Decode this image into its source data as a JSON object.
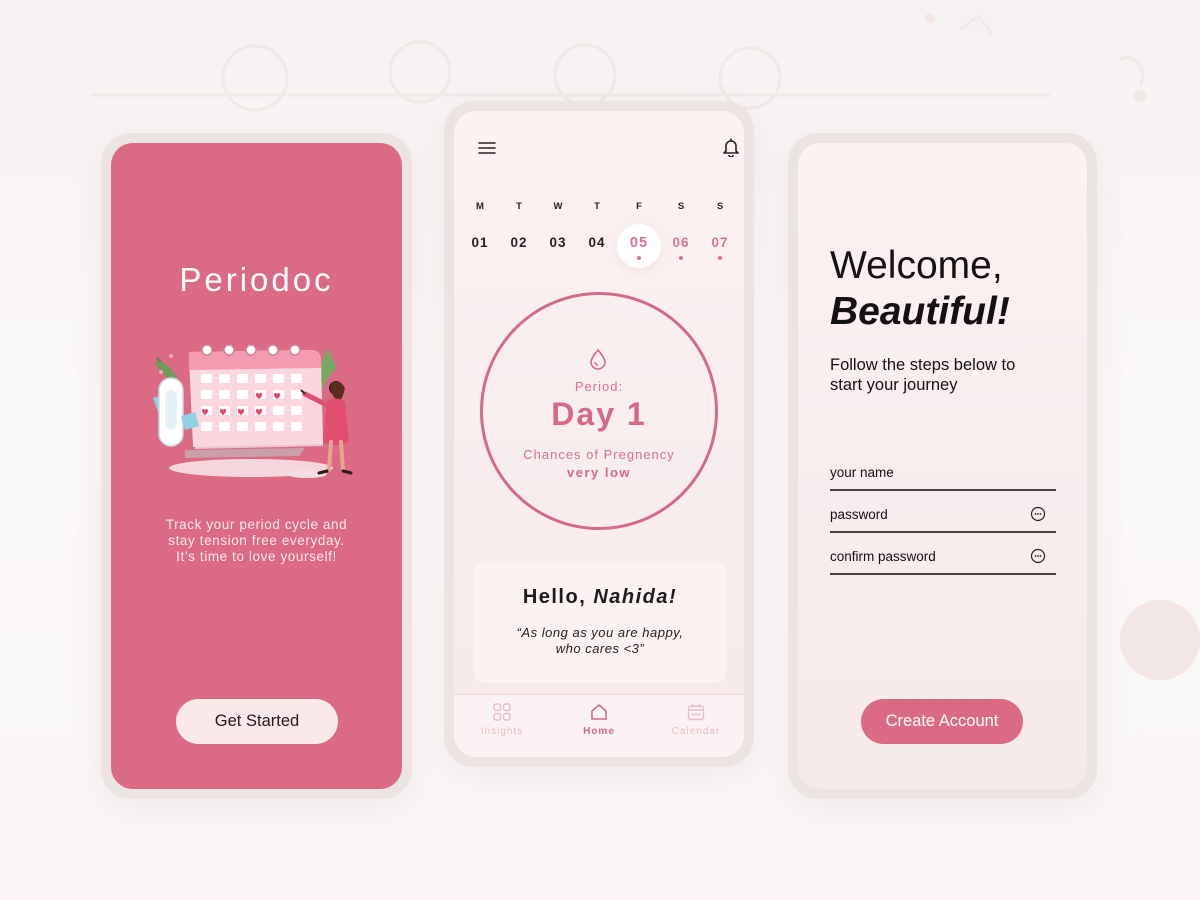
{
  "colors": {
    "brand_pink": "#db6a84",
    "accent_pink": "#d8738c",
    "button_light": "#f9e9e8",
    "background": "#f7f2f2"
  },
  "splash": {
    "logo": "Periodoc",
    "tagline": [
      "Track your period cycle and",
      "stay tension free everyday.",
      "It’s time to love yourself!"
    ],
    "cta_label": "Get Started"
  },
  "home": {
    "icons": {
      "menu": "menu-icon",
      "notifications": "bell-icon"
    },
    "week": [
      {
        "name": "M",
        "date": "01",
        "state": "past"
      },
      {
        "name": "T",
        "date": "02",
        "state": "past"
      },
      {
        "name": "W",
        "date": "03",
        "state": "past"
      },
      {
        "name": "T",
        "date": "04",
        "state": "past"
      },
      {
        "name": "F",
        "date": "05",
        "state": "today"
      },
      {
        "name": "S",
        "date": "06",
        "state": "future"
      },
      {
        "name": "S",
        "date": "07",
        "state": "future"
      }
    ],
    "period": {
      "label": "Period:",
      "day": "Day 1",
      "chance_label": "Chances of Pregnency",
      "chance_value": "very low"
    },
    "greeting": {
      "hello": "Hello,",
      "name": "Nahida!",
      "quote": [
        "“As long as you are happy,",
        "who cares <3”"
      ]
    },
    "nav": [
      {
        "label": "Insights",
        "icon": "grid-icon",
        "active": false
      },
      {
        "label": "Home",
        "icon": "home-icon",
        "active": true
      },
      {
        "label": "Calendar",
        "icon": "calendar-icon",
        "active": false
      }
    ]
  },
  "signup": {
    "title_line1": "Welcome,",
    "title_line2": "Beautiful!",
    "subtitle": [
      "Follow the steps below to",
      "start your journey"
    ],
    "fields": [
      {
        "label": "your name",
        "icon": ""
      },
      {
        "label": "password",
        "icon": "eye-icon"
      },
      {
        "label": "confirm password",
        "icon": "eye-icon"
      }
    ],
    "cta_label": "Create Account"
  }
}
